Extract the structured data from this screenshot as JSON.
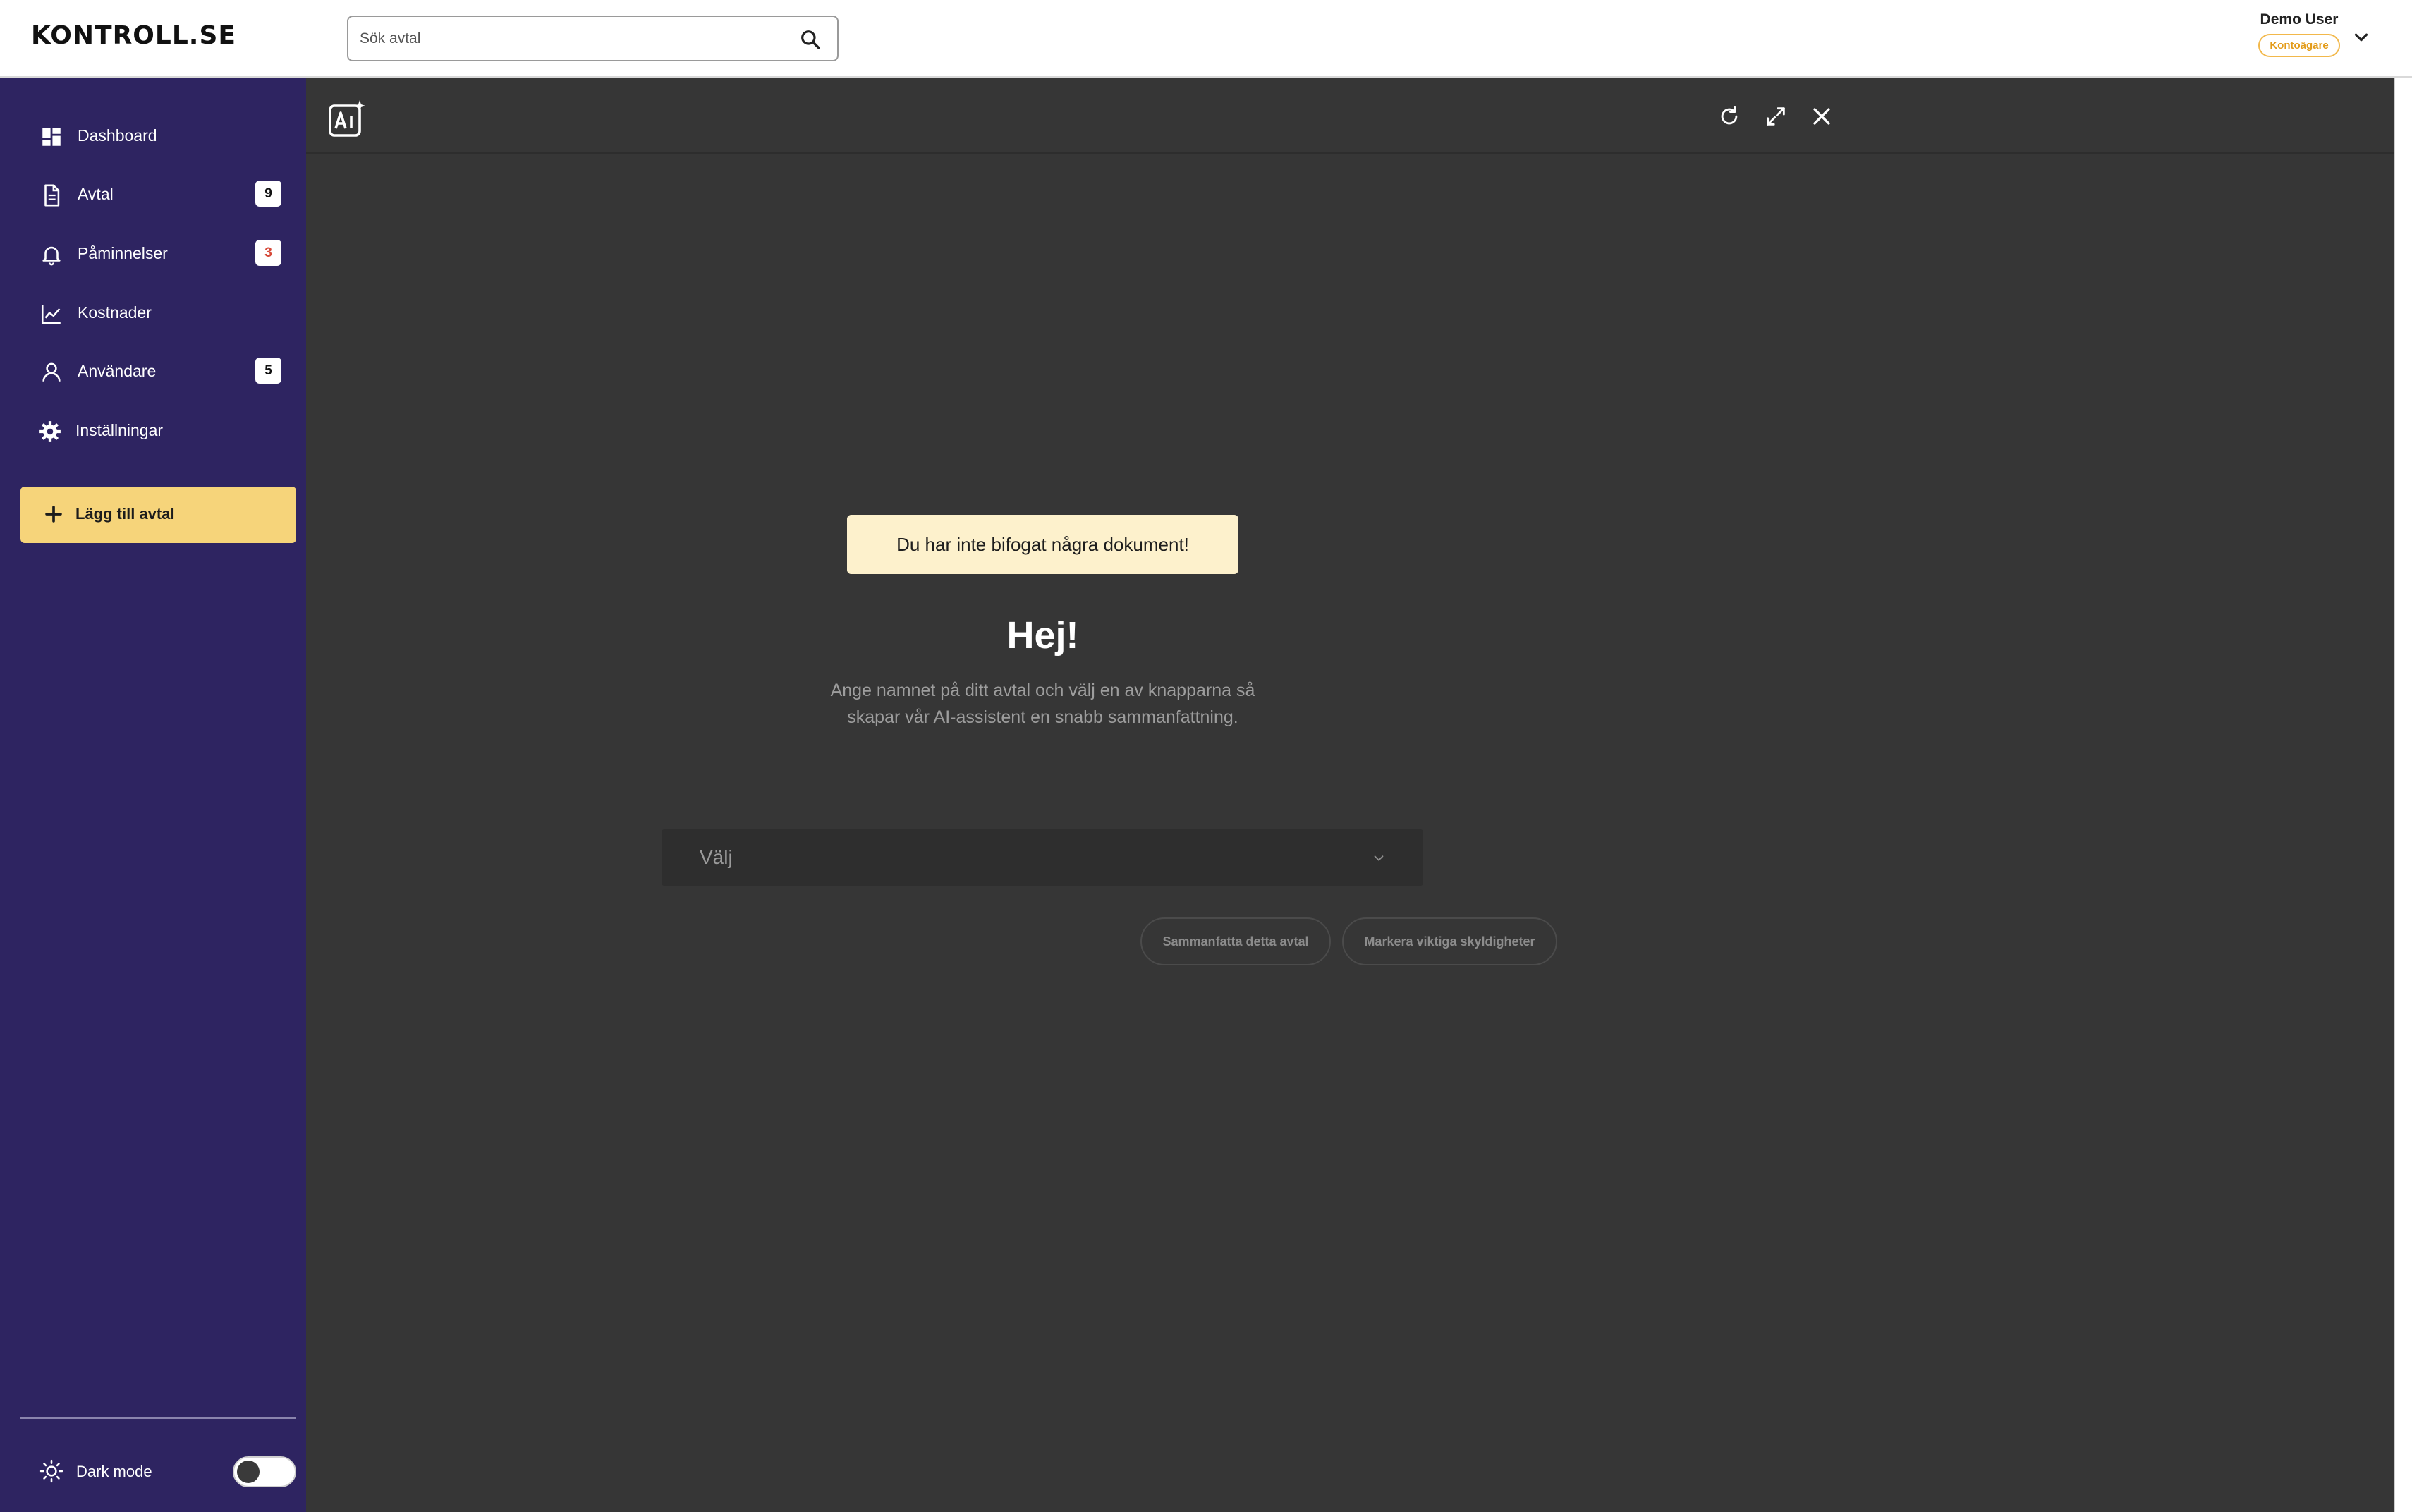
{
  "app": {
    "logo": "KONTROLL.SE"
  },
  "search": {
    "placeholder": "Sök avtal"
  },
  "user": {
    "name": "Demo User",
    "role": "Kontoägare"
  },
  "sidebar": {
    "items": [
      {
        "label": "Dashboard",
        "icon": "dashboard-icon"
      },
      {
        "label": "Avtal",
        "icon": "document-icon",
        "badge": "9"
      },
      {
        "label": "Påminnelser",
        "icon": "bell-icon",
        "badge": "3"
      },
      {
        "label": "Kostnader",
        "icon": "chart-line-icon"
      },
      {
        "label": "Användare",
        "icon": "user-icon",
        "badge": "5"
      },
      {
        "label": "Inställningar",
        "icon": "gear-icon"
      }
    ],
    "add_button": "Lägg till avtal",
    "dark_mode_label": "Dark mode",
    "dark_mode_on": false
  },
  "assistant": {
    "notice": "Du har inte bifogat några dokument!",
    "greeting": "Hej!",
    "subtitle_line1": "Ange namnet på ditt avtal och välj en av knapparna så",
    "subtitle_line2": "skapar vår AI-assistent en snabb sammanfattning.",
    "select_value": "Välj",
    "actions": [
      "Sammanfatta detta avtal",
      "Markera viktiga skyldigheter"
    ]
  },
  "colors": {
    "sidebar": "#2e2461",
    "accent": "#f6d47a",
    "panel": "#363636",
    "notice": "#fdf1cc",
    "role_badge": "#e39b18"
  }
}
